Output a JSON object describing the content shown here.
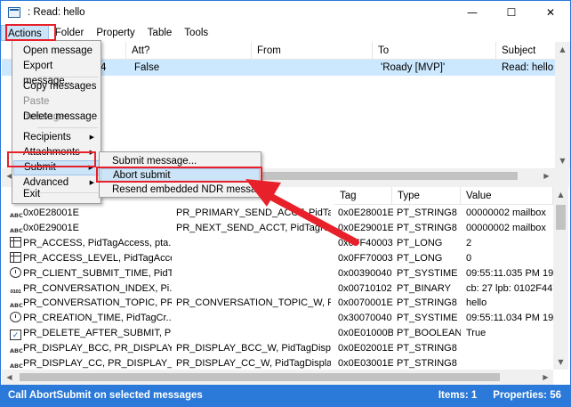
{
  "window": {
    "title": ": Read: hello",
    "minimize": "—",
    "maximize": "☐",
    "close": "✕"
  },
  "menubar": [
    "Actions",
    "Folder",
    "Property",
    "Table",
    "Tools"
  ],
  "actions_menu": {
    "items": [
      {
        "label": "Open message"
      },
      {
        "label": "Export message..."
      },
      {
        "label": "Copy messages"
      },
      {
        "label": "Paste messages..."
      },
      {
        "label": "Delete message"
      },
      {
        "label": "Recipients"
      },
      {
        "label": "Attachments"
      },
      {
        "label": "Submit"
      },
      {
        "label": "Advanced"
      },
      {
        "label": "Exit"
      }
    ]
  },
  "submit_submenu": {
    "items": [
      {
        "label": "Submit message..."
      },
      {
        "label": "Abort submit"
      },
      {
        "label": "Resend embedded NDR message"
      }
    ]
  },
  "message_table": {
    "columns": [
      "Att?",
      "From",
      "To",
      "Subject"
    ],
    "row": {
      "id_tail": "4",
      "att": "False",
      "from": "",
      "to": "'Roady [MVP]'",
      "subject": "Read: hello"
    }
  },
  "property_table": {
    "columns": [
      "Tag",
      "Type",
      "Value"
    ],
    "rows": [
      {
        "icon": "text-icon",
        "name": "0x0E28001E",
        "other": "PR_PRIMARY_SEND_ACCT, PidTagPri...",
        "tag": "0x0E28001E",
        "type": "PT_STRING8",
        "value": "00000002  mailbox"
      },
      {
        "icon": "text-icon",
        "name": "0x0E29001E",
        "other": "PR_NEXT_SEND_ACCT, PidTagNext...",
        "tag": "0x0E29001E",
        "type": "PT_STRING8",
        "value": "00000002  mailbox"
      },
      {
        "icon": "grid-icon",
        "name": "PR_ACCESS, PidTagAccess, pta...",
        "other": "",
        "tag": "0x0FF40003",
        "type": "PT_LONG",
        "value": "2"
      },
      {
        "icon": "grid-icon",
        "name": "PR_ACCESS_LEVEL, PidTagAcce...",
        "other": "",
        "tag": "0x0FF70003",
        "type": "PT_LONG",
        "value": "0"
      },
      {
        "icon": "clock-icon",
        "name": "PR_CLIENT_SUBMIT_TIME, PidT...",
        "other": "",
        "tag": "0x00390040",
        "type": "PT_SYSTIME",
        "value": "09:55:11.035 PM 19-"
      },
      {
        "icon": "binary-icon",
        "name": "PR_CONVERSATION_INDEX, Pi...",
        "other": "",
        "tag": "0x00710102",
        "type": "PT_BINARY",
        "value": "cb: 27 lpb: 0102F447"
      },
      {
        "icon": "text-icon",
        "name": "PR_CONVERSATION_TOPIC, PR...",
        "other": "PR_CONVERSATION_TOPIC_W, PI...",
        "tag": "0x0070001E",
        "type": "PT_STRING8",
        "value": "hello"
      },
      {
        "icon": "clock-icon",
        "name": "PR_CREATION_TIME, PidTagCr...",
        "other": "",
        "tag": "0x30070040",
        "type": "PT_SYSTIME",
        "value": "09:55:11.034 PM 19-"
      },
      {
        "icon": "checkbox-icon",
        "name": "PR_DELETE_AFTER_SUBMIT, Pid...",
        "other": "",
        "tag": "0x0E01000B",
        "type": "PT_BOOLEAN",
        "value": "True"
      },
      {
        "icon": "text-icon",
        "name": "PR_DISPLAY_BCC, PR_DISPLAY_...",
        "other": "PR_DISPLAY_BCC_W, PidTagDispl...",
        "tag": "0x0E02001E",
        "type": "PT_STRING8",
        "value": ""
      },
      {
        "icon": "text-icon",
        "name": "PR_DISPLAY_CC, PR_DISPLAY_...",
        "other": "PR_DISPLAY_CC_W, PidTagDispla...",
        "tag": "0x0E03001E",
        "type": "PT_STRING8",
        "value": ""
      }
    ]
  },
  "status": {
    "hint": "Call AbortSubmit on selected messages",
    "items": "Items: 1",
    "properties": "Properties: 56"
  },
  "annotation_color": "#e8202a"
}
